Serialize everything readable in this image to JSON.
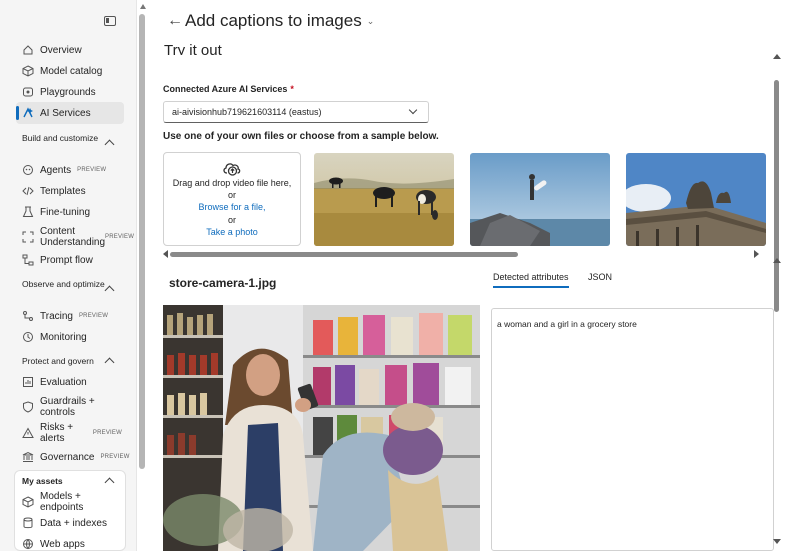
{
  "sidebar": {
    "items": {
      "overview": "Overview",
      "model_catalog": "Model catalog",
      "playgrounds": "Playgrounds",
      "ai_services": "AI Services",
      "agents": "Agents",
      "templates": "Templates",
      "fine_tuning": "Fine-tuning",
      "content_understanding": "Content Understanding",
      "prompt_flow": "Prompt flow",
      "tracing": "Tracing",
      "monitoring": "Monitoring",
      "evaluation": "Evaluation",
      "guardrails": "Guardrails + controls",
      "risks": "Risks + alerts",
      "governance": "Governance",
      "models_endpoints": "Models + endpoints",
      "data_indexes": "Data + indexes",
      "web_apps": "Web apps"
    },
    "groups": {
      "build": "Build and customize",
      "observe": "Observe and optimize",
      "protect": "Protect and govern",
      "assets": "My assets"
    },
    "badge": "PREVIEW"
  },
  "header": {
    "title": "Add captions to images"
  },
  "main": {
    "section_title": "Try it out",
    "service_label": "Connected Azure AI Services",
    "service_required": "*",
    "service_value": "ai-aivisionhub719621603114 (eastus)",
    "instructions": "Use one of your own files or choose from a sample below.",
    "dropzone": {
      "line1": "Drag and drop video file here,",
      "or1": "or",
      "browse": "Browse for a file,",
      "or2": "or",
      "photo": "Take a photo"
    },
    "file_name": "store-camera-1.jpg",
    "tabs": {
      "detected": "Detected attributes",
      "json": "JSON"
    },
    "caption": "a woman and a girl in a grocery store"
  },
  "colors": {
    "accent": "#0f6cbd",
    "required": "#c50f1f"
  }
}
